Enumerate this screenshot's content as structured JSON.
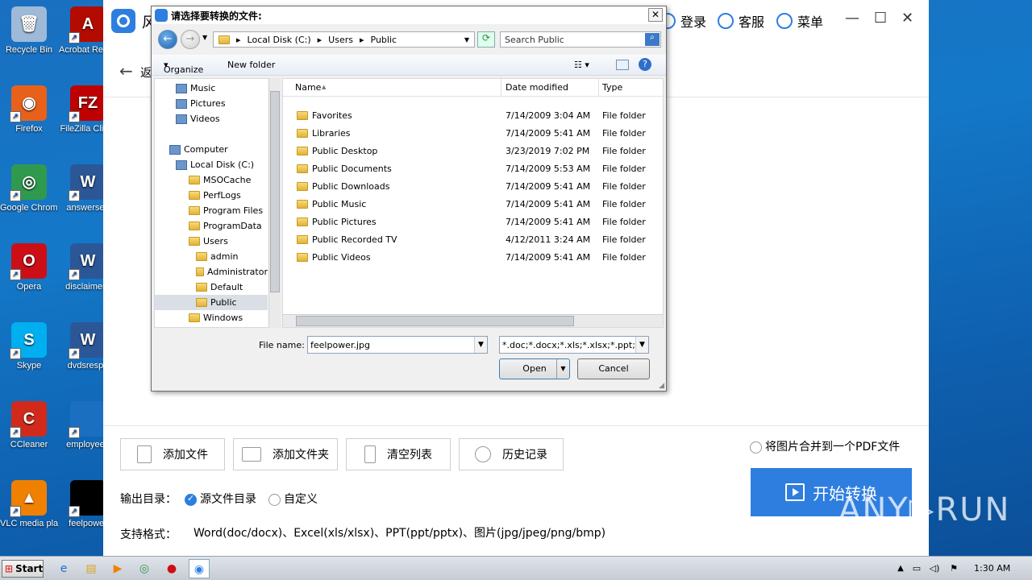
{
  "desktop": {
    "icons": [
      {
        "label": "Recycle Bin",
        "icon": "recycle-bin-icon",
        "color": "#9fb9d8",
        "glyph": "🗑"
      },
      {
        "label": "Acrobat Reader DC",
        "icon": "acrobat-icon",
        "color": "#b30b00",
        "glyph": "A"
      },
      {
        "label": "Firefox",
        "icon": "firefox-icon",
        "color": "#e8611a",
        "glyph": "◉"
      },
      {
        "label": "FileZilla Client",
        "icon": "filezilla-icon",
        "color": "#bf0000",
        "glyph": "FZ"
      },
      {
        "label": "Google Chrome",
        "icon": "chrome-icon",
        "color": "#2f9a4e",
        "glyph": "◎"
      },
      {
        "label": "answersen",
        "icon": "word-doc-icon",
        "color": "#2b5797",
        "glyph": "W"
      },
      {
        "label": "Opera",
        "icon": "opera-icon",
        "color": "#cc0f16",
        "glyph": "O"
      },
      {
        "label": "disclaimern",
        "icon": "word-doc-icon",
        "color": "#2b5797",
        "glyph": "W"
      },
      {
        "label": "Skype",
        "icon": "skype-icon",
        "color": "#00aff0",
        "glyph": "S"
      },
      {
        "label": "dvdsrespe",
        "icon": "word-doc-icon",
        "color": "#2b5797",
        "glyph": "W"
      },
      {
        "label": "CCleaner",
        "icon": "ccleaner-icon",
        "color": "#d12a1c",
        "glyph": "C"
      },
      {
        "label": "employeep",
        "icon": "blank-file-icon",
        "color": "#1a6fc0",
        "glyph": ""
      },
      {
        "label": "VLC media player",
        "icon": "vlc-icon",
        "color": "#f08000",
        "glyph": "▲"
      },
      {
        "label": "feelpower",
        "icon": "image-file-icon",
        "color": "#000000",
        "glyph": ""
      }
    ]
  },
  "app": {
    "name": "风",
    "header": {
      "login": "登录",
      "service": "客服",
      "menu": "菜单"
    },
    "back_label": "返",
    "toolbar": {
      "add_file": "添加文件",
      "add_folder": "添加文件夹",
      "clear_list": "清空列表",
      "history": "历史记录"
    },
    "merge_option": "将图片合并到一个PDF文件",
    "output_label": "输出目录：",
    "output_source": "源文件目录",
    "output_custom": "自定义",
    "formats_label": "支持格式：",
    "formats_value": "Word(doc/docx)、Excel(xls/xlsx)、PPT(ppt/pptx)、图片(jpg/jpeg/png/bmp)",
    "start_button": "开始转换",
    "accent": "#2e7ee0"
  },
  "dialog": {
    "title": "请选择要转换的文件:",
    "breadcrumb": [
      "Local Disk (C:)",
      "Users",
      "Public"
    ],
    "search_placeholder": "Search Public",
    "organize": "Organize",
    "new_folder": "New folder",
    "nav_items": [
      {
        "label": "Music",
        "indent": 1
      },
      {
        "label": "Pictures",
        "indent": 1
      },
      {
        "label": "Videos",
        "indent": 1
      },
      {
        "label": "Computer",
        "indent": 0
      },
      {
        "label": "Local Disk (C:)",
        "indent": 1
      },
      {
        "label": "MSOCache",
        "indent": 2
      },
      {
        "label": "PerfLogs",
        "indent": 2
      },
      {
        "label": "Program Files",
        "indent": 2
      },
      {
        "label": "ProgramData",
        "indent": 2
      },
      {
        "label": "Users",
        "indent": 2
      },
      {
        "label": "admin",
        "indent": 3
      },
      {
        "label": "Administrator",
        "indent": 3
      },
      {
        "label": "Default",
        "indent": 3
      },
      {
        "label": "Public",
        "indent": 3,
        "selected": true
      },
      {
        "label": "Windows",
        "indent": 2
      }
    ],
    "columns": {
      "name": "Name",
      "date": "Date modified",
      "type": "Type"
    },
    "files": [
      {
        "name": "Favorites",
        "date": "7/14/2009 3:04 AM",
        "type": "File folder"
      },
      {
        "name": "Libraries",
        "date": "7/14/2009 5:41 AM",
        "type": "File folder"
      },
      {
        "name": "Public Desktop",
        "date": "3/23/2019 7:02 PM",
        "type": "File folder"
      },
      {
        "name": "Public Documents",
        "date": "7/14/2009 5:53 AM",
        "type": "File folder"
      },
      {
        "name": "Public Downloads",
        "date": "7/14/2009 5:41 AM",
        "type": "File folder"
      },
      {
        "name": "Public Music",
        "date": "7/14/2009 5:41 AM",
        "type": "File folder"
      },
      {
        "name": "Public Pictures",
        "date": "7/14/2009 5:41 AM",
        "type": "File folder"
      },
      {
        "name": "Public Recorded TV",
        "date": "4/12/2011 3:24 AM",
        "type": "File folder"
      },
      {
        "name": "Public Videos",
        "date": "7/14/2009 5:41 AM",
        "type": "File folder"
      }
    ],
    "file_name_label": "File name:",
    "file_name_value": "feelpower.jpg",
    "file_type_value": "*.doc;*.docx;*.xls;*.xlsx;*.ppt;*.p",
    "open_label": "Open",
    "cancel_label": "Cancel"
  },
  "taskbar": {
    "start": "Start",
    "clock": "1:30 AM"
  },
  "watermark": "ANY▷RUN"
}
